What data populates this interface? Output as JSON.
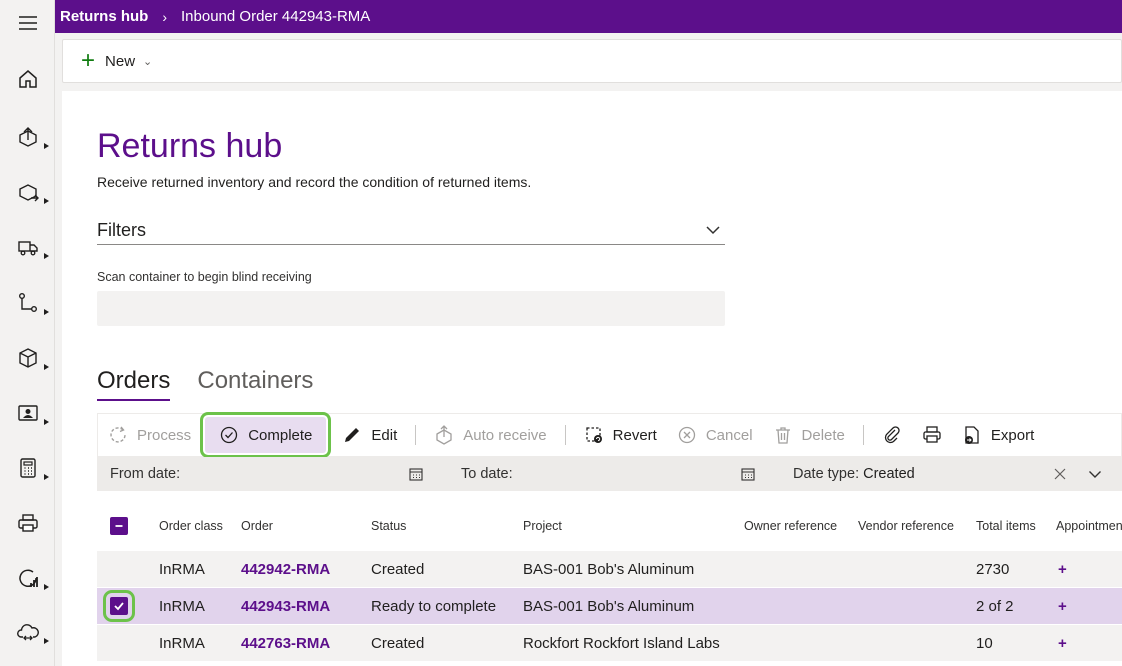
{
  "topbar": {
    "app_name": "Returns hub",
    "breadcrumb": "Inbound Order 442943-RMA"
  },
  "commandbar": {
    "new_label": "New"
  },
  "page": {
    "title": "Returns hub",
    "subtitle": "Receive returned inventory and record the condition of returned items.",
    "filters_label": "Filters",
    "scan_label": "Scan container to begin blind receiving",
    "scan_value": ""
  },
  "tabs": [
    {
      "label": "Orders",
      "active": true
    },
    {
      "label": "Containers",
      "active": false
    }
  ],
  "toolbar": {
    "process": "Process",
    "complete": "Complete",
    "edit": "Edit",
    "auto_receive": "Auto receive",
    "revert": "Revert",
    "cancel": "Cancel",
    "delete": "Delete",
    "export": "Export"
  },
  "filter_row": {
    "from_date": "From date:",
    "to_date": "To date:",
    "date_type_label": "Date type:",
    "date_type_value": "Created"
  },
  "columns": {
    "order_class": "Order class",
    "order": "Order",
    "status": "Status",
    "project": "Project",
    "owner_reference": "Owner reference",
    "vendor_reference": "Vendor reference",
    "total_items": "Total items",
    "appointment": "Appointmen"
  },
  "rows": [
    {
      "order_class": "InRMA",
      "order": "442942-RMA",
      "status": "Created",
      "project": "BAS-001 Bob's Aluminum",
      "total_items": "2730",
      "appointment": "+"
    },
    {
      "order_class": "InRMA",
      "order": "442943-RMA",
      "status": "Ready to complete",
      "project": "BAS-001 Bob's Aluminum",
      "total_items": "2 of 2",
      "appointment": "+"
    },
    {
      "order_class": "InRMA",
      "order": "442763-RMA",
      "status": "Created",
      "project": "Rockfort Rockfort Island Labs",
      "total_items": "10",
      "appointment": "+"
    }
  ],
  "colors": {
    "brand": "#5c0f8b",
    "highlight": "#6cc24a",
    "selected_row": "#e1d3ec"
  }
}
